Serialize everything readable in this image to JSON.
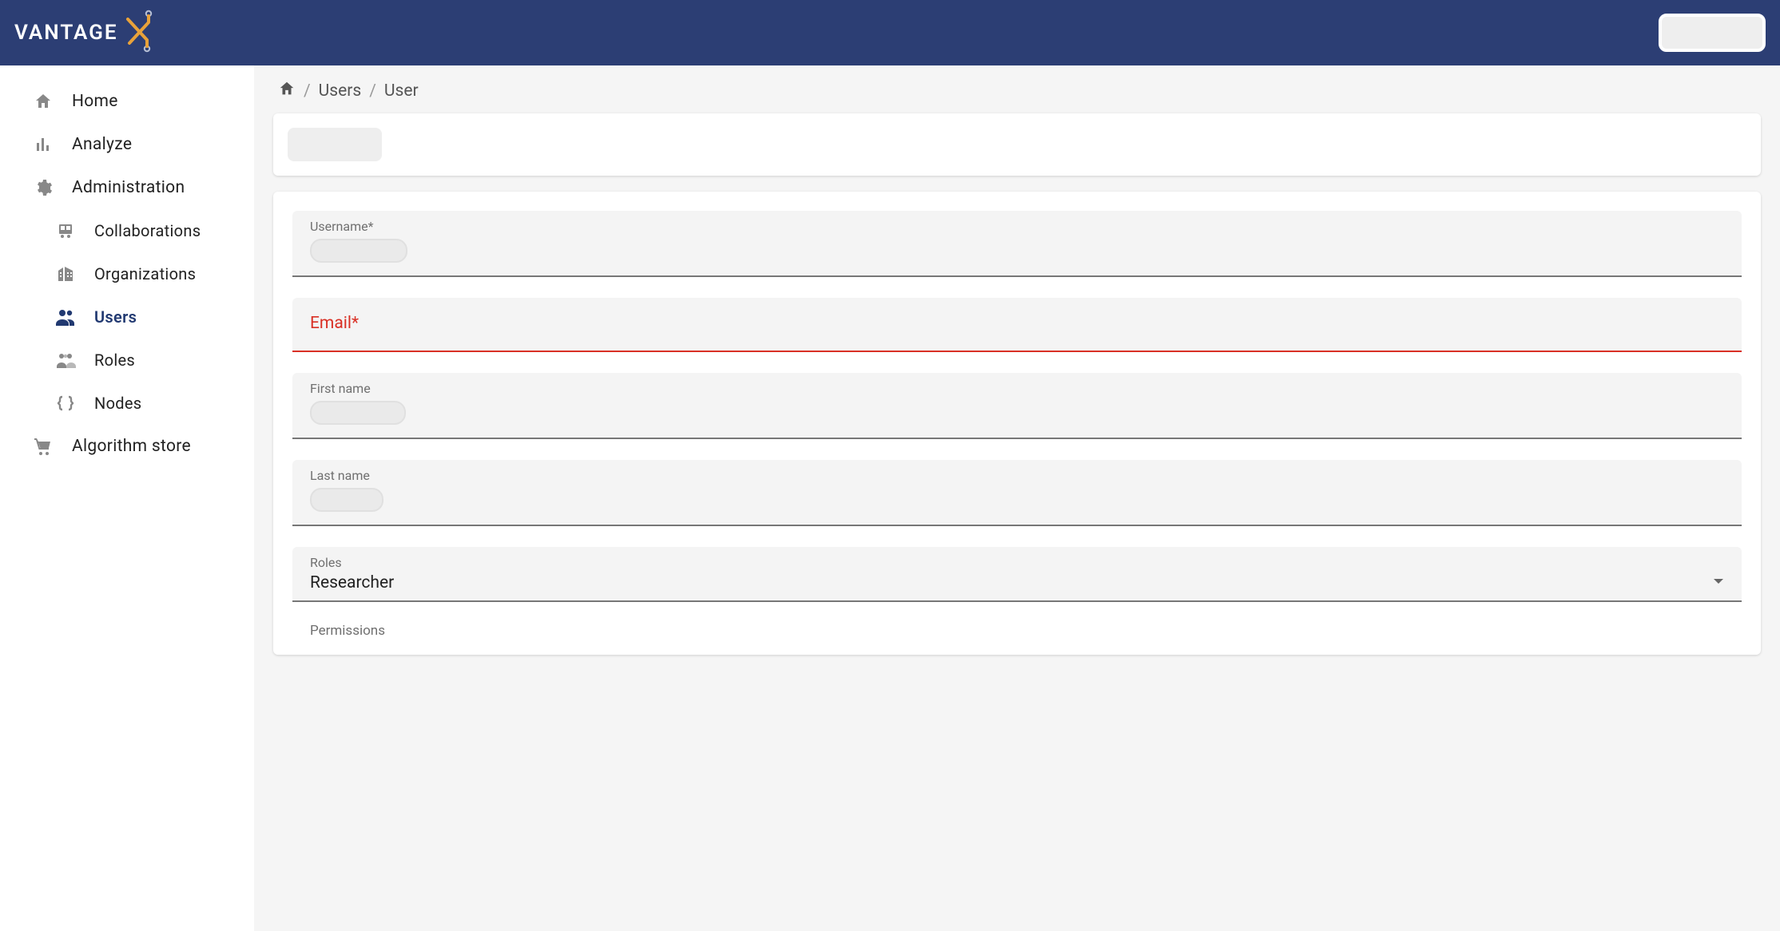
{
  "brand": {
    "name": "VANTAGE"
  },
  "sidebar": {
    "items": [
      {
        "label": "Home"
      },
      {
        "label": "Analyze"
      },
      {
        "label": "Administration"
      },
      {
        "label": "Collaborations"
      },
      {
        "label": "Organizations"
      },
      {
        "label": "Users"
      },
      {
        "label": "Roles"
      },
      {
        "label": "Nodes"
      },
      {
        "label": "Algorithm store"
      }
    ]
  },
  "breadcrumb": {
    "level1": "Users",
    "level2": "User"
  },
  "form": {
    "username_label": "Username*",
    "email_label": "Email*",
    "firstname_label": "First name",
    "lastname_label": "Last name",
    "roles_label": "Roles",
    "roles_value": "Researcher",
    "permissions_label": "Permissions"
  }
}
